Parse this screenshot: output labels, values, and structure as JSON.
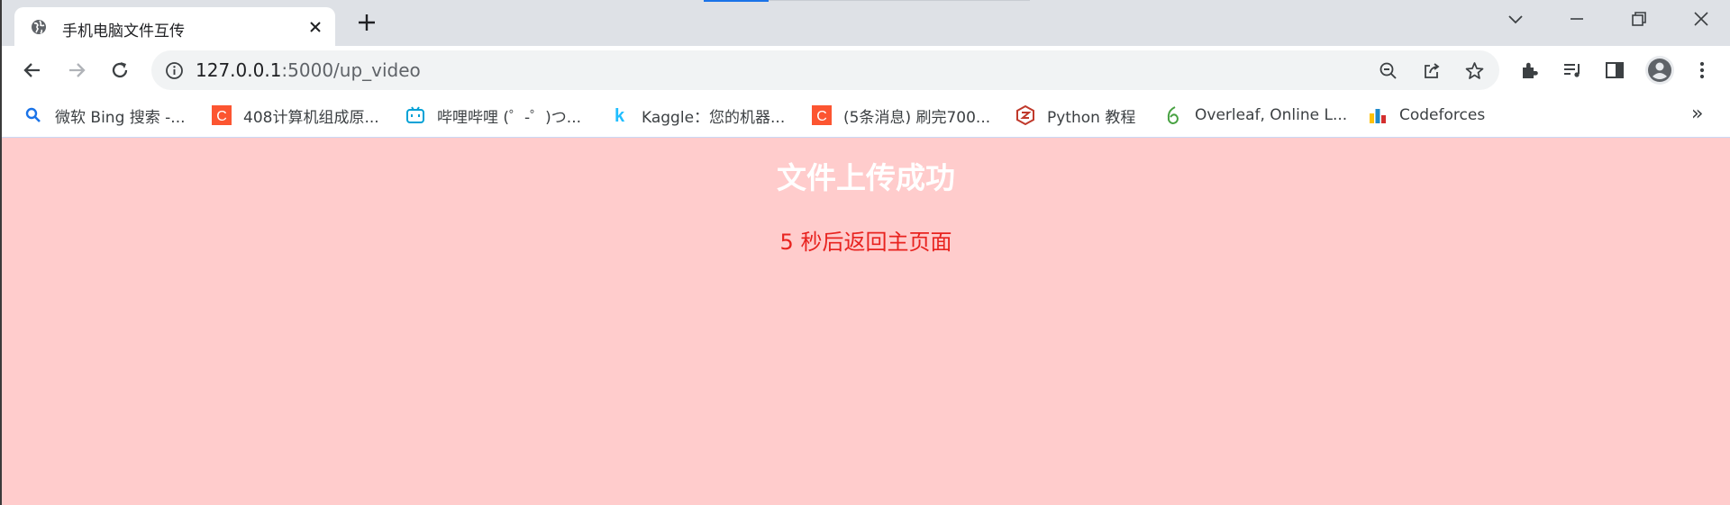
{
  "browser": {
    "tab": {
      "title": "手机电脑文件互传",
      "favicon": "globe-icon"
    },
    "address_bar": {
      "host": "127.0.0.1",
      "path": ":5000/up_video"
    }
  },
  "bookmarks": [
    {
      "label": "微软 Bing 搜索 -...",
      "icon": "bing-search-icon",
      "color": "#1a73e8"
    },
    {
      "label": "408计算机组成原...",
      "icon": "csdn-icon",
      "color": "#fc5531"
    },
    {
      "label": "哔哩哔哩 (゜-゜)つ...",
      "icon": "bilibili-icon",
      "color": "#00a1d6"
    },
    {
      "label": "Kaggle：您的机器...",
      "icon": "kaggle-icon",
      "color": "#20beff"
    },
    {
      "label": "(5条消息) 刷完700...",
      "icon": "csdn-icon",
      "color": "#fc5531"
    },
    {
      "label": "Python 教程",
      "icon": "runoob-icon",
      "color": "#c0392b"
    },
    {
      "label": "Overleaf, Online L...",
      "icon": "overleaf-icon",
      "color": "#47a141"
    },
    {
      "label": "Codeforces",
      "icon": "codeforces-icon",
      "color": "#1f8acb"
    }
  ],
  "bookmarks_overflow": "»",
  "page": {
    "title": "文件上传成功",
    "message": "5 秒后返回主页面",
    "background": "#ffcccc",
    "message_color": "#e8231f"
  }
}
